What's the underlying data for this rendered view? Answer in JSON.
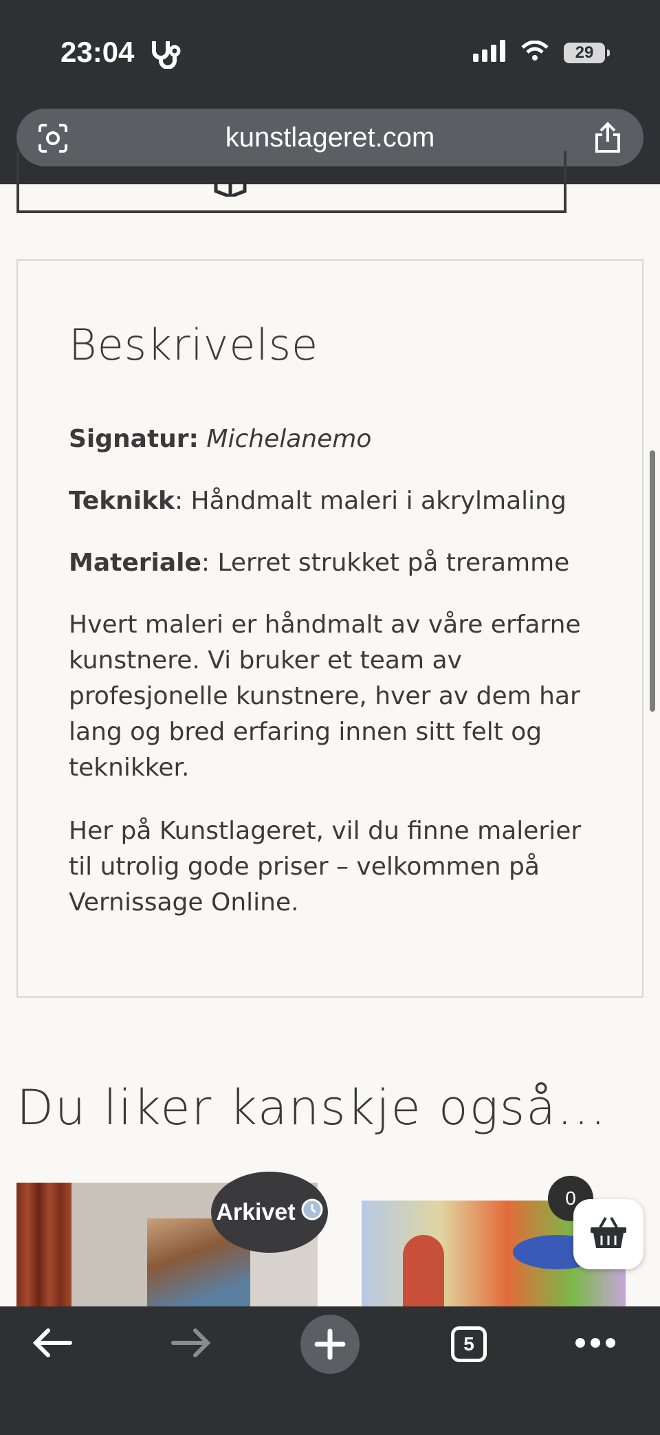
{
  "status": {
    "time": "23:04",
    "battery": "29"
  },
  "browser": {
    "url": "kunstlageret.com",
    "tabs_count": "5"
  },
  "description": {
    "title": "Beskrivelse",
    "signatur_label": "Signatur:",
    "signatur_value": "Michelanemo",
    "teknikk_label": "Teknikk",
    "teknikk_value": ": Håndmalt maleri i akrylmaling",
    "materiale_label": "Materiale",
    "materiale_value": ": Lerret strukket på treramme",
    "paragraph1": "Hvert maleri er håndmalt av våre erfarne kunstnere. Vi bruker et team av profesjonelle kunstnere, hver av dem har lang og bred erfaring innen sitt felt og teknikker.",
    "paragraph2": "Her på Kunstlageret, vil du finne malerier til utrolig gode priser – velkommen på Vernissage Online."
  },
  "related": {
    "title": "Du liker kanskje også..."
  },
  "badges": {
    "arkivet": "Arkivet",
    "cart_count": "0"
  },
  "colors": {
    "bar_bg": "#2e3033",
    "page_bg": "#faf8f5",
    "text": "#3a3a3a"
  }
}
